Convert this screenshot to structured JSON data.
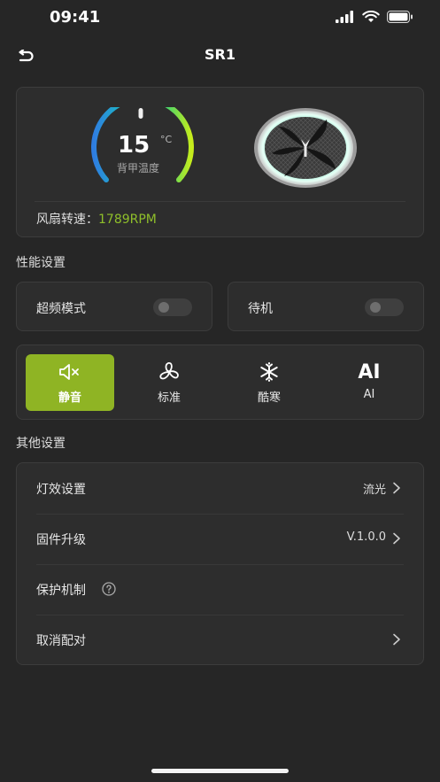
{
  "status_bar": {
    "time": "09:41"
  },
  "nav": {
    "title": "SR1",
    "back_icon": "back-arrow-icon"
  },
  "device": {
    "temperature": "15",
    "temperature_unit": "°C",
    "temperature_label": "背甲温度",
    "fan_speed_label": "风扇转速：",
    "fan_speed_value": "1789RPM"
  },
  "performance": {
    "title": "性能设置",
    "overclock": {
      "label": "超频模式",
      "enabled": false
    },
    "standby": {
      "label": "待机",
      "enabled": false
    }
  },
  "modes": {
    "active": "mute",
    "items": [
      {
        "label": "静音",
        "icon": "mute-speaker-icon"
      },
      {
        "label": "标准",
        "icon": "fan-icon"
      },
      {
        "label": "酷寒",
        "icon": "snowflake-icon"
      },
      {
        "label": "AI",
        "icon_text": "AI"
      }
    ]
  },
  "other": {
    "title": "其他设置",
    "rows": [
      {
        "label": "灯效设置",
        "value": "流光"
      },
      {
        "label": "固件升级",
        "value": "V.1.0.0"
      },
      {
        "label": "保护机制"
      },
      {
        "label": "取消配对"
      }
    ]
  },
  "colors": {
    "accent": "#8fb424",
    "speed_text": "#8fbf2a",
    "background": "#262626",
    "card": "#2d2d2d"
  }
}
